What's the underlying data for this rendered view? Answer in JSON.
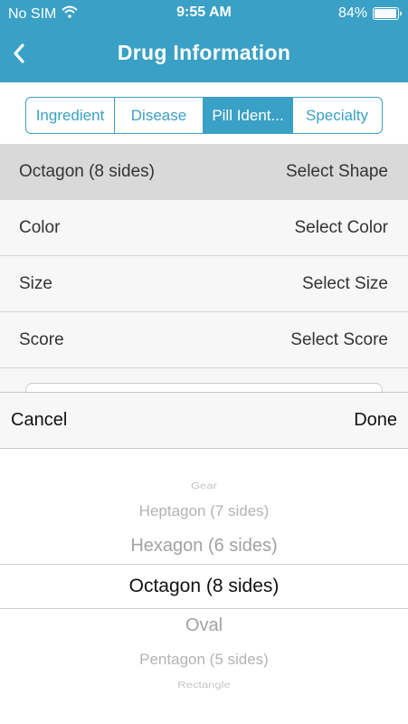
{
  "status": {
    "carrier": "No SIM",
    "time": "9:55 AM",
    "battery": "84%",
    "battery_level": 0.84
  },
  "nav": {
    "title": "Drug Information"
  },
  "tabs": [
    {
      "label": "Ingredient"
    },
    {
      "label": "Disease"
    },
    {
      "label": "Pill Ident..."
    },
    {
      "label": "Specialty"
    }
  ],
  "rows": [
    {
      "value": "Octagon (8 sides)",
      "action": "Select Shape"
    },
    {
      "value": "Color",
      "action": "Select Color"
    },
    {
      "value": "Size",
      "action": "Select Size"
    },
    {
      "value": "Score",
      "action": "Select Score"
    }
  ],
  "picker": {
    "cancel": "Cancel",
    "done": "Done",
    "options": [
      "Gear",
      "Heptagon (7 sides)",
      "Hexagon (6 sides)",
      "Octagon (8 sides)",
      "Oval",
      "Pentagon (5 sides)",
      "Rectangle"
    ]
  },
  "colors": {
    "accent": "#3aa0c5"
  }
}
